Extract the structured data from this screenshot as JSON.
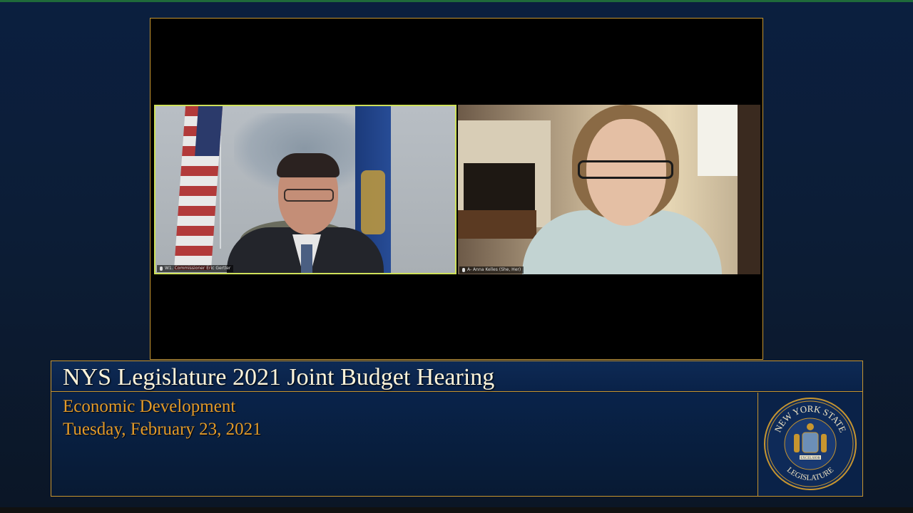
{
  "participants": [
    {
      "label": "W1. Commissioner Eric Gertler",
      "speaking": true
    },
    {
      "label": "A- Anna Kelles (She, Her)",
      "speaking": false
    }
  ],
  "lower_third": {
    "title": "NYS Legislature 2021 Joint Budget Hearing",
    "topic": "Economic Development",
    "date": "Tuesday, February 23, 2021"
  },
  "seal": {
    "top_text": "NEW YORK STATE",
    "bottom_text": "LEGISLATURE",
    "motto": "EXCELSIOR"
  },
  "colors": {
    "gold_border": "#c7952f",
    "title_text": "#fbf3da",
    "subtitle_text": "#e29a2b",
    "active_speaker": "#cfe15a"
  }
}
